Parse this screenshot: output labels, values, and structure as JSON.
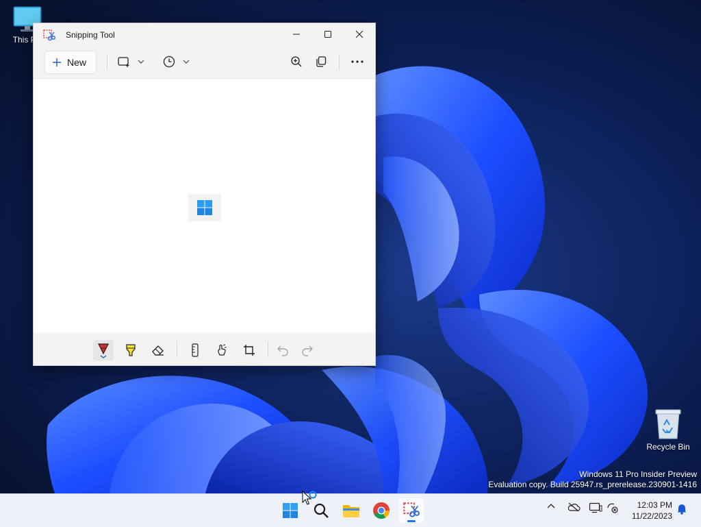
{
  "desktop": {
    "icons": [
      {
        "label": "This PC",
        "icon": "computer-icon"
      },
      {
        "label": "Recycle Bin",
        "icon": "recycle-bin-icon"
      }
    ],
    "watermark_line1": "Windows 11 Pro Insider Preview",
    "watermark_line2": "Evaluation copy. Build 25947.rs_prerelease.230901-1416"
  },
  "window": {
    "title": "Snipping Tool",
    "toolbar": {
      "new_label": "New",
      "tools": [
        "snip-mode-rectangle-icon",
        "delay-timer-icon",
        "zoom-in-icon",
        "copy-icon",
        "more-options-icon"
      ]
    },
    "bottom_tools": [
      "ballpoint-pen-icon",
      "highlighter-icon",
      "eraser-icon",
      "ruler-icon",
      "touch-writing-icon",
      "crop-icon",
      "undo-icon",
      "redo-icon"
    ]
  },
  "taskbar": {
    "apps": [
      "start-icon",
      "search-icon",
      "file-explorer-icon",
      "chrome-icon",
      "snipping-tool-icon"
    ],
    "tray": [
      "show-hidden-icons-icon",
      "onedrive-icon",
      "display-icon",
      "network-icon",
      "notifications-icon"
    ],
    "time": "12:03 PM",
    "date": "11/22/2023"
  },
  "colors": {
    "accent": "#1a73e8",
    "wallpaper_dark": "#0a1a44",
    "wallpaper_blue": "#1a4cff"
  }
}
